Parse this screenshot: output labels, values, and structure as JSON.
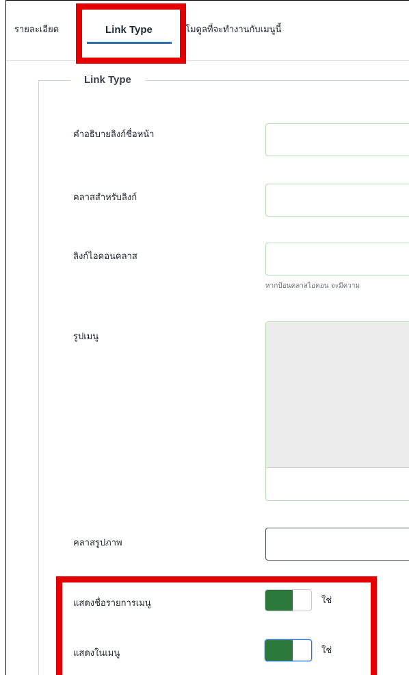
{
  "tabs": {
    "details": "รายละเอียด",
    "link_type": "Link Type",
    "modules": "โมดูลที่จะทำงานกับเมนูนี้"
  },
  "fieldset": {
    "legend": "Link Type",
    "fields": {
      "link_title_attr": {
        "label": "คำอธิบายลิงก์ชื่อหน้า",
        "value": ""
      },
      "link_class": {
        "label": "คลาสสำหรับลิงก์",
        "value": ""
      },
      "link_icon_class": {
        "label": "ลิงก์ไอคอนคลาส",
        "value": "",
        "help": "หากป้อนคลาสไอคอน จะมีความ"
      },
      "menu_image": {
        "label": "รูปเมนู"
      },
      "image_class": {
        "label": "คลาสรูปภาพ",
        "value": ""
      },
      "show_title": {
        "label": "แสดงชื่อรายการเมนู",
        "state": "ใช่"
      },
      "show_in_menu": {
        "label": "แสดงในเมนู",
        "state": "ใช่"
      }
    }
  },
  "colors": {
    "highlight": "#e50000",
    "toggle_on": "#2c7a3b",
    "tab_active": "#2f6fa8",
    "field_border": "#b7dcb7"
  }
}
